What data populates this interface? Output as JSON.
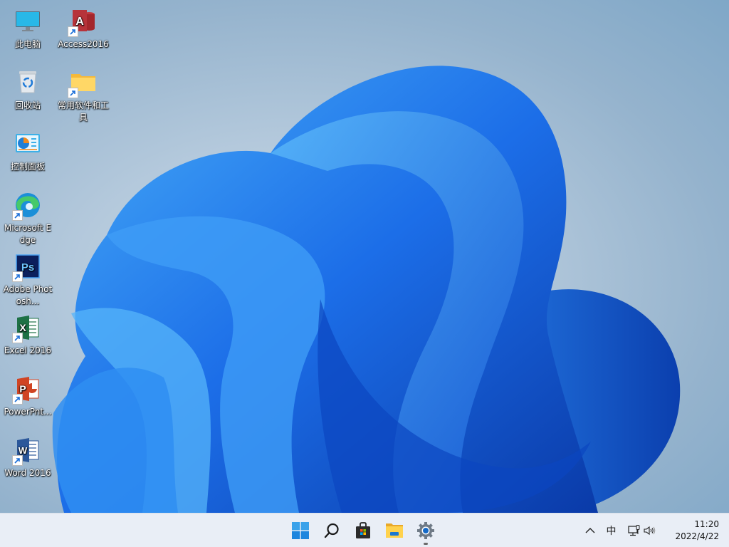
{
  "desktop": {
    "icons": [
      {
        "label": "此电脑",
        "icon": "this-pc-icon",
        "shortcut": false
      },
      {
        "label": "Access2016",
        "icon": "access-icon",
        "shortcut": true
      },
      {
        "label": "回收站",
        "icon": "recycle-bin-icon",
        "shortcut": false
      },
      {
        "label": "常用软件和工具",
        "icon": "folder-icon",
        "shortcut": true
      },
      {
        "label": "控制面板",
        "icon": "control-panel-icon",
        "shortcut": false
      },
      {
        "label": "Microsoft Edge",
        "icon": "edge-icon",
        "shortcut": true
      },
      {
        "label": "Adobe Photosh...",
        "icon": "photoshop-icon",
        "shortcut": true
      },
      {
        "label": "Excel 2016",
        "icon": "excel-icon",
        "shortcut": true
      },
      {
        "label": "PowerPnt...",
        "icon": "powerpoint-icon",
        "shortcut": true
      },
      {
        "label": "Word 2016",
        "icon": "word-icon",
        "shortcut": true
      }
    ]
  },
  "taskbar": {
    "apps": [
      {
        "name": "start",
        "icon": "windows-logo-icon"
      },
      {
        "name": "search",
        "icon": "search-icon"
      },
      {
        "name": "store",
        "icon": "store-icon"
      },
      {
        "name": "file-explorer",
        "icon": "folder-icon"
      },
      {
        "name": "settings",
        "icon": "gear-icon",
        "running": true
      }
    ],
    "tray": {
      "overflow_icon": "chevron-up-icon",
      "ime_label": "中",
      "network_icon": "network-icon",
      "volume_icon": "volume-icon"
    },
    "clock": {
      "time": "11:20",
      "date": "2022/4/22"
    }
  },
  "colors": {
    "accent": "#0078d4",
    "bloom_light": "#3aa0f5",
    "bloom_dark": "#0a3fb8",
    "taskbar_bg": "#e9eef6"
  }
}
